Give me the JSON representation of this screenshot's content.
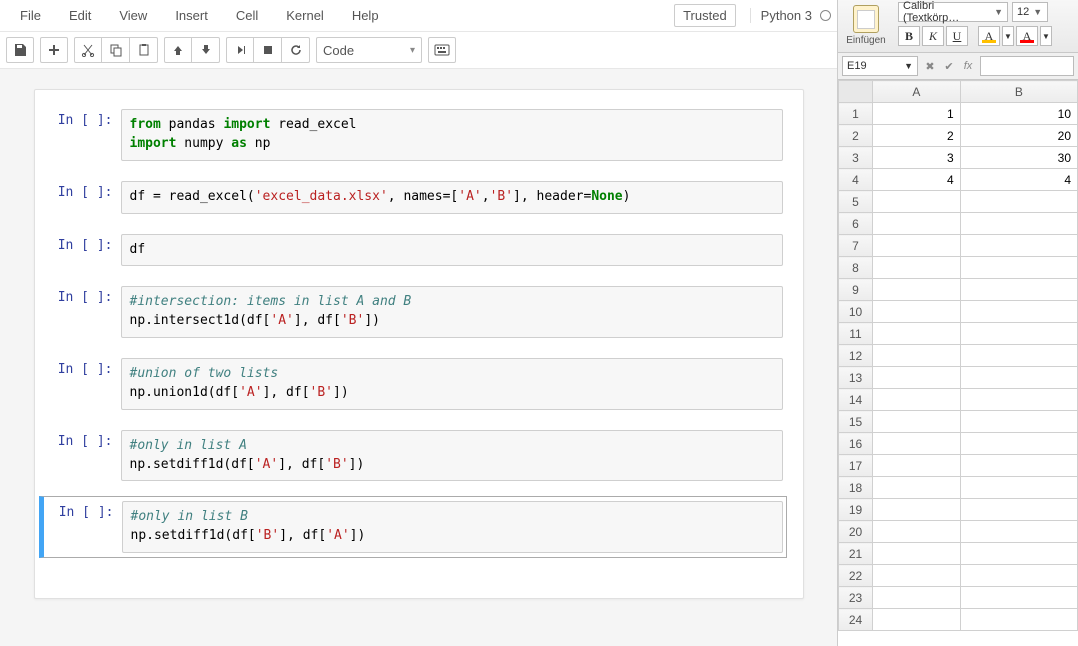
{
  "jupyter": {
    "menu": [
      "File",
      "Edit",
      "View",
      "Insert",
      "Cell",
      "Kernel",
      "Help"
    ],
    "trusted": "Trusted",
    "kernel_name": "Python 3",
    "cell_type": "Code",
    "cells": [
      {
        "prompt": "In [ ]:",
        "tokens": [
          [
            "kw",
            "from"
          ],
          [
            "nm",
            " pandas "
          ],
          [
            "kw",
            "import"
          ],
          [
            "nm",
            " read_excel\n"
          ],
          [
            "kw",
            "import"
          ],
          [
            "nm",
            " numpy "
          ],
          [
            "kw",
            "as"
          ],
          [
            "nm",
            " np"
          ]
        ],
        "selected": false
      },
      {
        "prompt": "In [ ]:",
        "tokens": [
          [
            "nm",
            "df = read_excel("
          ],
          [
            "str",
            "'excel_data.xlsx'"
          ],
          [
            "nm",
            ", names=["
          ],
          [
            "str",
            "'A'"
          ],
          [
            "nm",
            ","
          ],
          [
            "str",
            "'B'"
          ],
          [
            "nm",
            "], header="
          ],
          [
            "lit",
            "None"
          ],
          [
            "nm",
            ")"
          ]
        ],
        "selected": false
      },
      {
        "prompt": "In [ ]:",
        "tokens": [
          [
            "nm",
            "df"
          ]
        ],
        "selected": false
      },
      {
        "prompt": "In [ ]:",
        "tokens": [
          [
            "cmt",
            "#intersection: items in list A and B"
          ],
          [
            "nm",
            "\nnp.intersect1d(df["
          ],
          [
            "str",
            "'A'"
          ],
          [
            "nm",
            "], df["
          ],
          [
            "str",
            "'B'"
          ],
          [
            "nm",
            "])"
          ]
        ],
        "selected": false
      },
      {
        "prompt": "In [ ]:",
        "tokens": [
          [
            "cmt",
            "#union of two lists"
          ],
          [
            "nm",
            "\nnp.union1d(df["
          ],
          [
            "str",
            "'A'"
          ],
          [
            "nm",
            "], df["
          ],
          [
            "str",
            "'B'"
          ],
          [
            "nm",
            "])"
          ]
        ],
        "selected": false
      },
      {
        "prompt": "In [ ]:",
        "tokens": [
          [
            "cmt",
            "#only in list A"
          ],
          [
            "nm",
            "\nnp.setdiff1d(df["
          ],
          [
            "str",
            "'A'"
          ],
          [
            "nm",
            "], df["
          ],
          [
            "str",
            "'B'"
          ],
          [
            "nm",
            "])"
          ]
        ],
        "selected": false
      },
      {
        "prompt": "In [ ]:",
        "tokens": [
          [
            "cmt",
            "#only in list B"
          ],
          [
            "nm",
            "\nnp.setdiff1d(df["
          ],
          [
            "str",
            "'B'"
          ],
          [
            "nm",
            "], df["
          ],
          [
            "str",
            "'A'"
          ],
          [
            "nm",
            "])"
          ]
        ],
        "selected": true
      }
    ]
  },
  "excel": {
    "paste_label": "Einfügen",
    "font_name": "Calibri (Textkörp…",
    "font_size": "12",
    "fmt_b": "B",
    "fmt_i": "K",
    "fmt_u": "U",
    "fmt_a_fill": "A",
    "fmt_a_font": "A",
    "fill_color": "#ffc000",
    "font_color": "#ff0000",
    "cell_ref": "E19",
    "fx_label": "fx",
    "columns": [
      "A",
      "B"
    ],
    "rows": [
      {
        "n": 1,
        "A": "1",
        "B": "10"
      },
      {
        "n": 2,
        "A": "2",
        "B": "20"
      },
      {
        "n": 3,
        "A": "3",
        "B": "30"
      },
      {
        "n": 4,
        "A": "4",
        "B": "4"
      },
      {
        "n": 5,
        "A": "",
        "B": ""
      },
      {
        "n": 6,
        "A": "",
        "B": ""
      },
      {
        "n": 7,
        "A": "",
        "B": ""
      },
      {
        "n": 8,
        "A": "",
        "B": ""
      },
      {
        "n": 9,
        "A": "",
        "B": ""
      },
      {
        "n": 10,
        "A": "",
        "B": ""
      },
      {
        "n": 11,
        "A": "",
        "B": ""
      },
      {
        "n": 12,
        "A": "",
        "B": ""
      },
      {
        "n": 13,
        "A": "",
        "B": ""
      },
      {
        "n": 14,
        "A": "",
        "B": ""
      },
      {
        "n": 15,
        "A": "",
        "B": ""
      },
      {
        "n": 16,
        "A": "",
        "B": ""
      },
      {
        "n": 17,
        "A": "",
        "B": ""
      },
      {
        "n": 18,
        "A": "",
        "B": ""
      },
      {
        "n": 19,
        "A": "",
        "B": ""
      },
      {
        "n": 20,
        "A": "",
        "B": ""
      },
      {
        "n": 21,
        "A": "",
        "B": ""
      },
      {
        "n": 22,
        "A": "",
        "B": ""
      },
      {
        "n": 23,
        "A": "",
        "B": ""
      },
      {
        "n": 24,
        "A": "",
        "B": ""
      }
    ],
    "chart_data": {
      "type": "table",
      "columns": [
        "A",
        "B"
      ],
      "rows": [
        [
          1,
          10
        ],
        [
          2,
          20
        ],
        [
          3,
          30
        ],
        [
          4,
          4
        ]
      ]
    }
  }
}
